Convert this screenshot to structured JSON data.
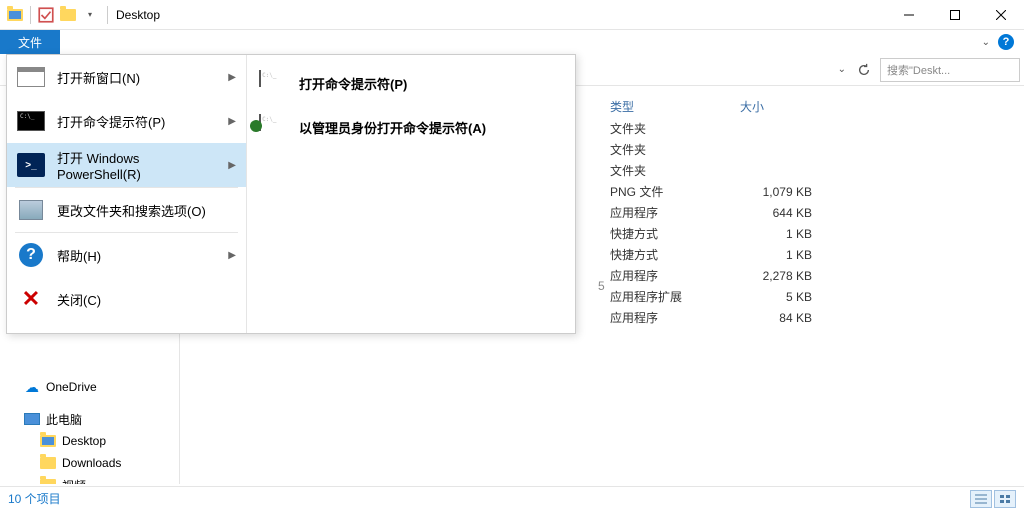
{
  "window": {
    "title": "Desktop"
  },
  "file_tab": "文件",
  "search": {
    "placeholder": "搜索\"Deskt..."
  },
  "menu": {
    "items": [
      {
        "label": "打开新窗口(N)",
        "has_arrow": true
      },
      {
        "label": "打开命令提示符(P)",
        "has_arrow": true
      },
      {
        "label": "打开 Windows PowerShell(R)",
        "has_arrow": true,
        "selected": true
      },
      {
        "label": "更改文件夹和搜索选项(O)",
        "has_arrow": false
      },
      {
        "label": "帮助(H)",
        "has_arrow": true
      },
      {
        "label": "关闭(C)",
        "has_arrow": false
      }
    ],
    "submenu": [
      {
        "label": "打开命令提示符(P)"
      },
      {
        "label": "以管理员身份打开命令提示符(A)"
      }
    ]
  },
  "columns": {
    "type": "类型",
    "size": "大小"
  },
  "obscured_char": "5",
  "files": [
    {
      "type": "文件夹",
      "size": ""
    },
    {
      "type": "文件夹",
      "size": ""
    },
    {
      "type": "文件夹",
      "size": ""
    },
    {
      "type": "PNG 文件",
      "size": "1,079 KB"
    },
    {
      "type": "应用程序",
      "size": "644 KB"
    },
    {
      "type": "快捷方式",
      "size": "1 KB"
    },
    {
      "type": "快捷方式",
      "size": "1 KB"
    },
    {
      "type": "应用程序",
      "size": "2,278 KB"
    },
    {
      "type": "应用程序扩展",
      "size": "5 KB"
    },
    {
      "type": "应用程序",
      "size": "84 KB"
    }
  ],
  "sidebar": {
    "items": [
      {
        "label": "OneDrive",
        "icon": "cloud"
      },
      {
        "label": "此电脑",
        "icon": "pc"
      },
      {
        "label": "Desktop",
        "icon": "folder-blue",
        "indent": true
      },
      {
        "label": "Downloads",
        "icon": "folder",
        "indent": true
      },
      {
        "label": "视频",
        "icon": "folder",
        "indent": true
      }
    ]
  },
  "status": "10 个项目"
}
